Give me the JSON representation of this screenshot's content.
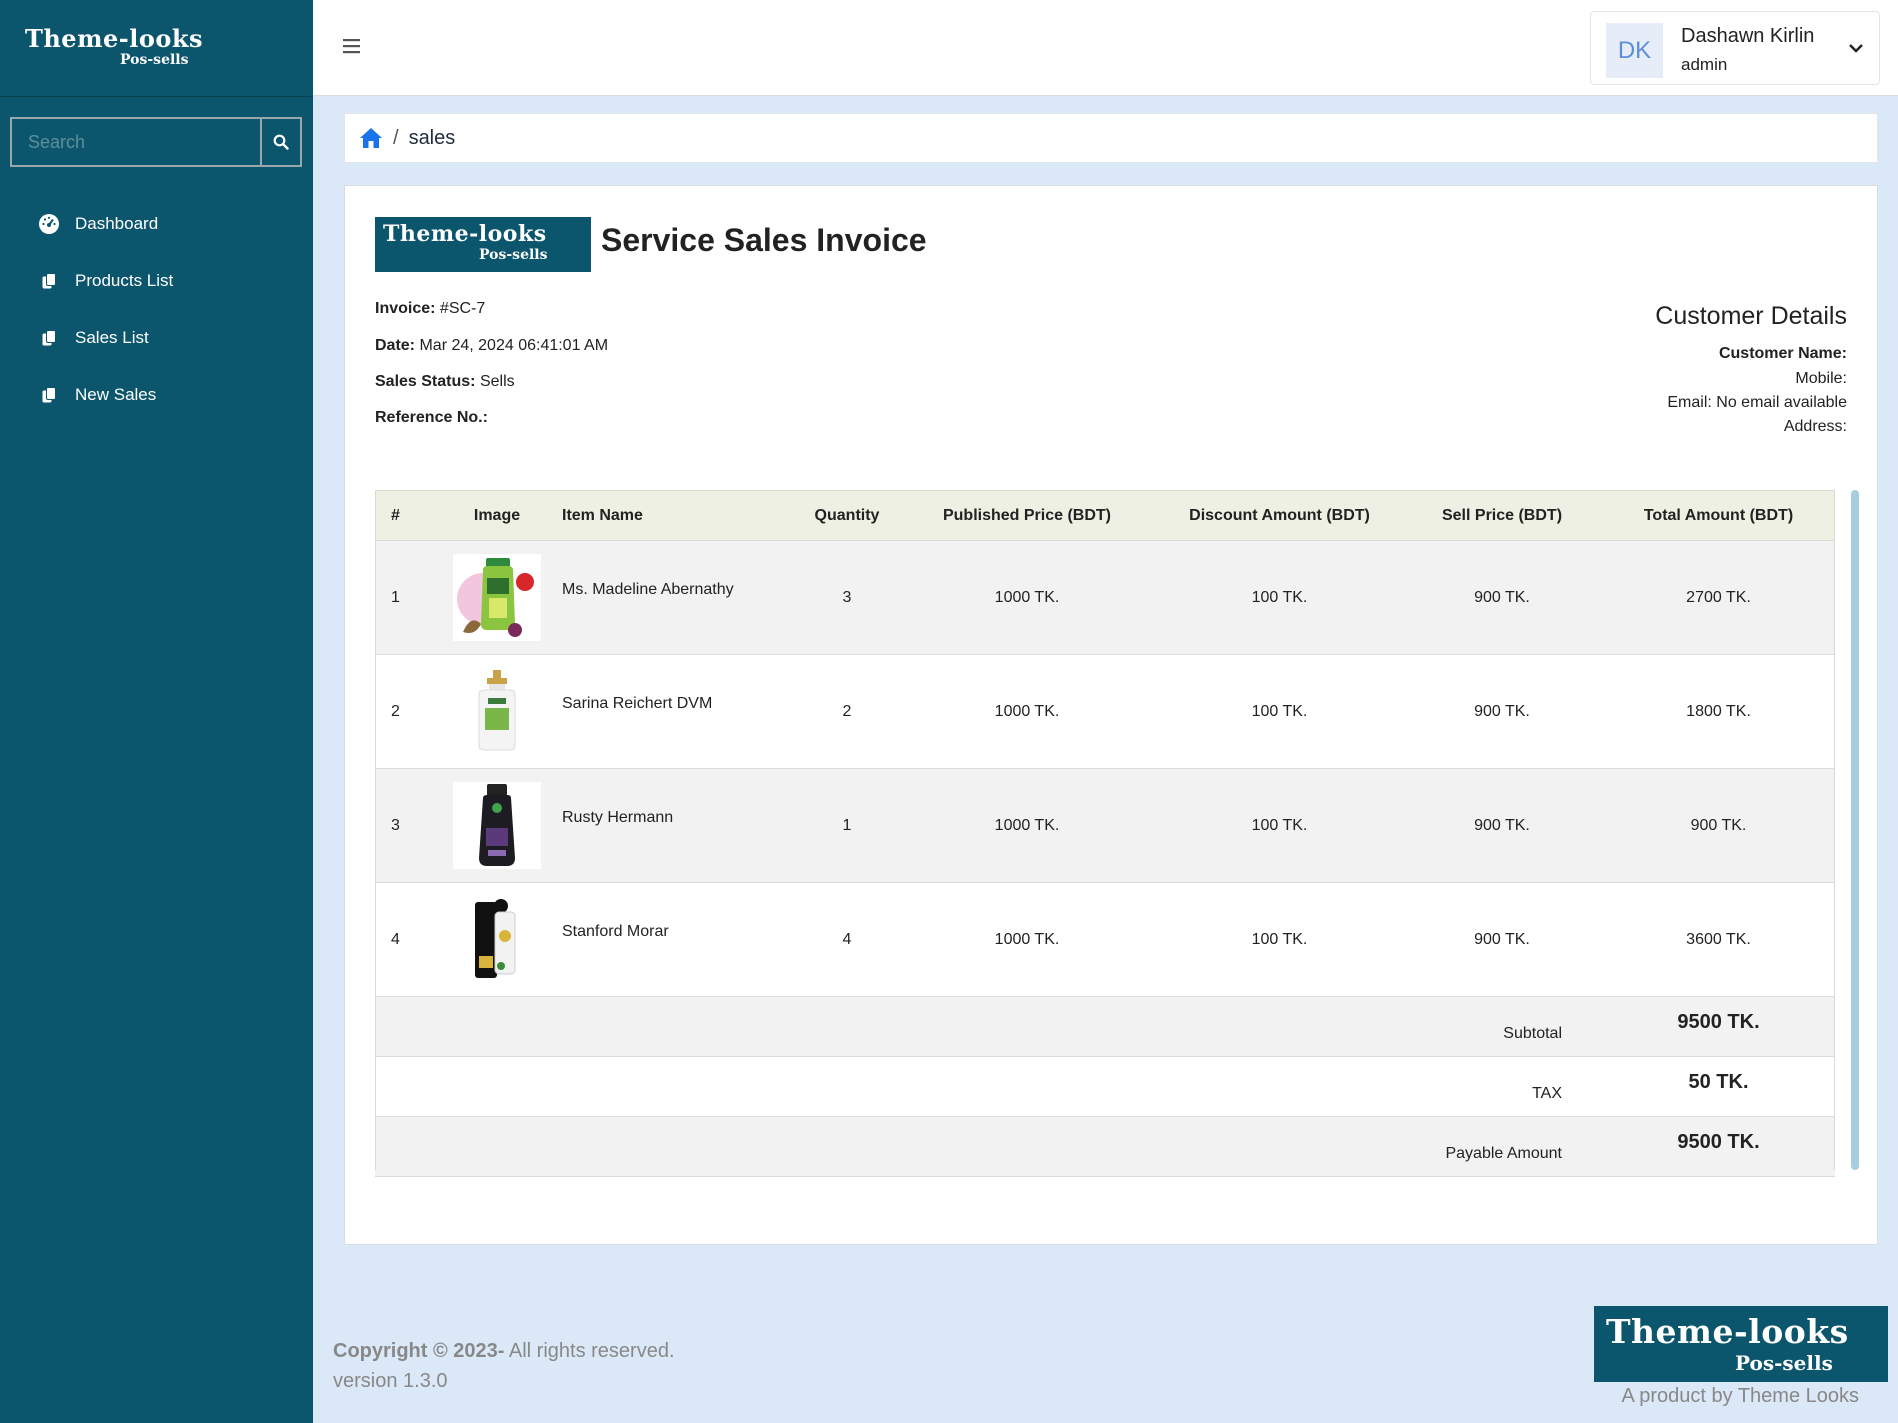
{
  "brand": {
    "name": "Theme-looks",
    "sub": "Pos-sells"
  },
  "search": {
    "placeholder": "Search"
  },
  "sidebar": {
    "items": [
      {
        "label": "Dashboard",
        "icon": "dashboard-gauge-icon"
      },
      {
        "label": "Products List",
        "icon": "copy-icon"
      },
      {
        "label": "Sales List",
        "icon": "copy-icon"
      },
      {
        "label": "New Sales",
        "icon": "copy-icon"
      }
    ]
  },
  "header": {
    "user": {
      "initials": "DK",
      "name": "Dashawn Kirlin",
      "role": "admin"
    }
  },
  "breadcrumb": {
    "separator": "/",
    "current": "sales"
  },
  "invoice": {
    "title": "Service Sales Invoice",
    "invoice_label": "Invoice:",
    "invoice_value": "#SC-7",
    "date_label": "Date:",
    "date_value": "Mar 24, 2024 06:41:01 AM",
    "status_label": "Sales Status:",
    "status_value": "Sells",
    "reference_label": "Reference No.:",
    "reference_value": ""
  },
  "customer": {
    "heading": "Customer Details",
    "name_label": "Customer Name:",
    "mobile_label": "Mobile:",
    "email_label": "Email:",
    "email_value": "No email available",
    "address_label": "Address:"
  },
  "table": {
    "headers": [
      "#",
      "Image",
      "Item Name",
      "Quantity",
      "Published Price (BDT)",
      "Discount Amount (BDT)",
      "Sell Price (BDT)",
      "Total Amount (BDT)"
    ],
    "rows": [
      {
        "no": "1",
        "name": "Ms. Madeline Abernathy",
        "qty": "3",
        "published": "1000 TK.",
        "discount": "100 TK.",
        "sell": "900 TK.",
        "total": "2700 TK."
      },
      {
        "no": "2",
        "name": "Sarina Reichert DVM",
        "qty": "2",
        "published": "1000 TK.",
        "discount": "100 TK.",
        "sell": "900 TK.",
        "total": "1800 TK."
      },
      {
        "no": "3",
        "name": "Rusty Hermann",
        "qty": "1",
        "published": "1000 TK.",
        "discount": "100 TK.",
        "sell": "900 TK.",
        "total": "900 TK."
      },
      {
        "no": "4",
        "name": "Stanford Morar",
        "qty": "4",
        "published": "1000 TK.",
        "discount": "100 TK.",
        "sell": "900 TK.",
        "total": "3600 TK."
      }
    ],
    "summary": {
      "subtotal_label": "Subtotal",
      "subtotal_value": "9500 TK.",
      "tax_label": "TAX",
      "tax_value": "50 TK.",
      "payable_label": "Payable Amount",
      "payable_value": "9500 TK."
    }
  },
  "footer": {
    "copyright_bold": "Copyright © 2023-",
    "copyright_rest": " All rights reserved.",
    "version": "version 1.3.0",
    "tagline": "A product by Theme Looks"
  },
  "colors": {
    "sidebar": "#0c566d",
    "background": "#dbe8f8",
    "table_header": "#eef0e4",
    "accent": "#1a73e8"
  }
}
